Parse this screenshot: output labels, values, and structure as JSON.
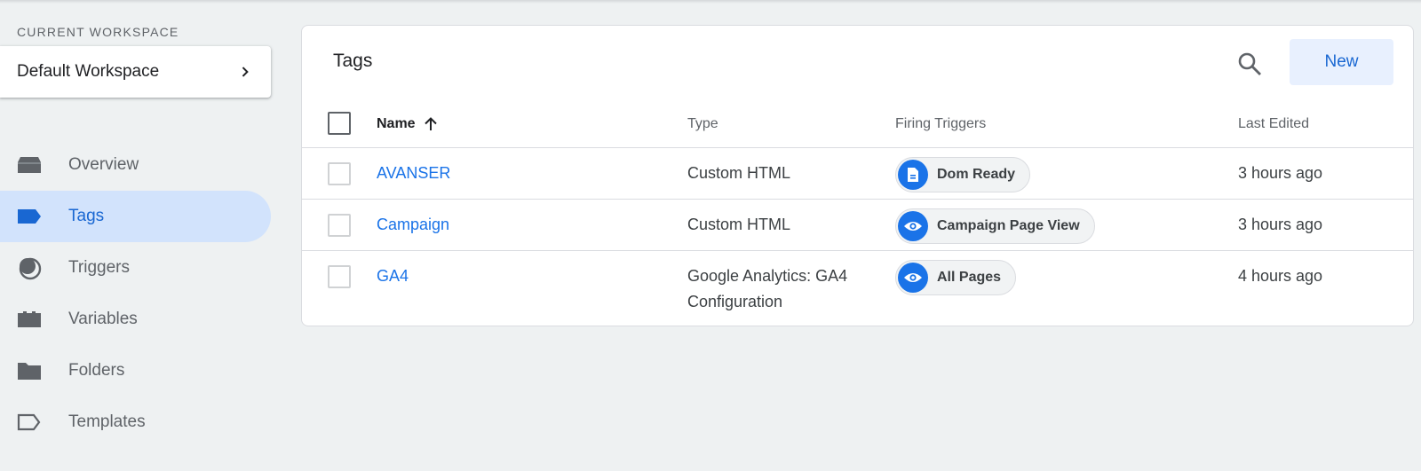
{
  "workspace": {
    "section_label": "CURRENT WORKSPACE",
    "name": "Default Workspace"
  },
  "nav": {
    "items": [
      {
        "label": "Overview",
        "icon": "overview-icon"
      },
      {
        "label": "Tags",
        "icon": "tag-icon",
        "active": true
      },
      {
        "label": "Triggers",
        "icon": "trigger-icon"
      },
      {
        "label": "Variables",
        "icon": "variables-icon"
      },
      {
        "label": "Folders",
        "icon": "folder-icon"
      },
      {
        "label": "Templates",
        "icon": "template-icon"
      }
    ]
  },
  "panel": {
    "title": "Tags",
    "new_label": "New",
    "search_icon": "search-icon"
  },
  "table": {
    "columns": {
      "name": "Name",
      "type": "Type",
      "triggers": "Firing Triggers",
      "edited": "Last Edited"
    },
    "sort_icon": "arrow-up-icon",
    "rows": [
      {
        "name": "AVANSER",
        "type": "Custom HTML",
        "trigger": "Dom Ready",
        "trigger_icon": "document-icon",
        "edited": "3 hours ago"
      },
      {
        "name": "Campaign",
        "type": "Custom HTML",
        "trigger": "Campaign Page View",
        "trigger_icon": "eye-icon",
        "edited": "3 hours ago"
      },
      {
        "name": "GA4",
        "type": "Google Analytics: GA4 Configuration",
        "trigger": "All Pages",
        "trigger_icon": "eye-icon",
        "edited": "4 hours ago"
      }
    ]
  },
  "colors": {
    "accent": "#1a73e8",
    "active_nav_bg": "#d2e3fc",
    "new_button_bg": "#e8f0fe"
  }
}
